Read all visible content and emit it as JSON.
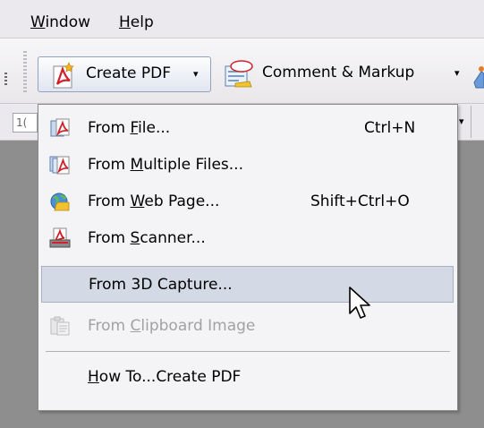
{
  "menubar": {
    "window": "Window",
    "window_underline": "W",
    "window_rest": "indow",
    "help": "Help",
    "help_underline": "H",
    "help_rest": "elp"
  },
  "toolbar": {
    "create_pdf": "Create PDF",
    "comment_markup": "Comment & Markup",
    "dropdown_arrow": "▾",
    "zoom_partial": "1("
  },
  "menu": {
    "items": [
      {
        "prefix": "From ",
        "underline": "F",
        "rest": "ile...",
        "shortcut": "Ctrl+N",
        "icon": "pdf-from-file-icon"
      },
      {
        "prefix": "From ",
        "underline": "M",
        "rest": "ultiple Files...",
        "shortcut": "",
        "icon": "pdf-multiple-files-icon"
      },
      {
        "prefix": "From ",
        "underline": "W",
        "rest": "eb Page...",
        "shortcut": "Shift+Ctrl+O",
        "icon": "pdf-web-page-icon"
      },
      {
        "prefix": "From ",
        "underline": "S",
        "rest": "canner...",
        "shortcut": "",
        "icon": "pdf-scanner-icon"
      },
      {
        "prefix": "From 3D Capture...",
        "underline": "",
        "rest": "",
        "shortcut": "",
        "icon": ""
      },
      {
        "prefix": "From ",
        "underline": "C",
        "rest": "lipboard Image",
        "shortcut": "",
        "icon": "pdf-clipboard-icon"
      },
      {
        "prefix": "",
        "underline": "H",
        "rest": "ow To...Create PDF",
        "shortcut": "",
        "icon": ""
      }
    ]
  },
  "colors": {
    "background": "#8e8e8e",
    "menu_bg": "#f4f3f6",
    "highlight": "#d3d9e5",
    "disabled_text": "#a2a2a2",
    "pdf_red": "#d0202a"
  }
}
